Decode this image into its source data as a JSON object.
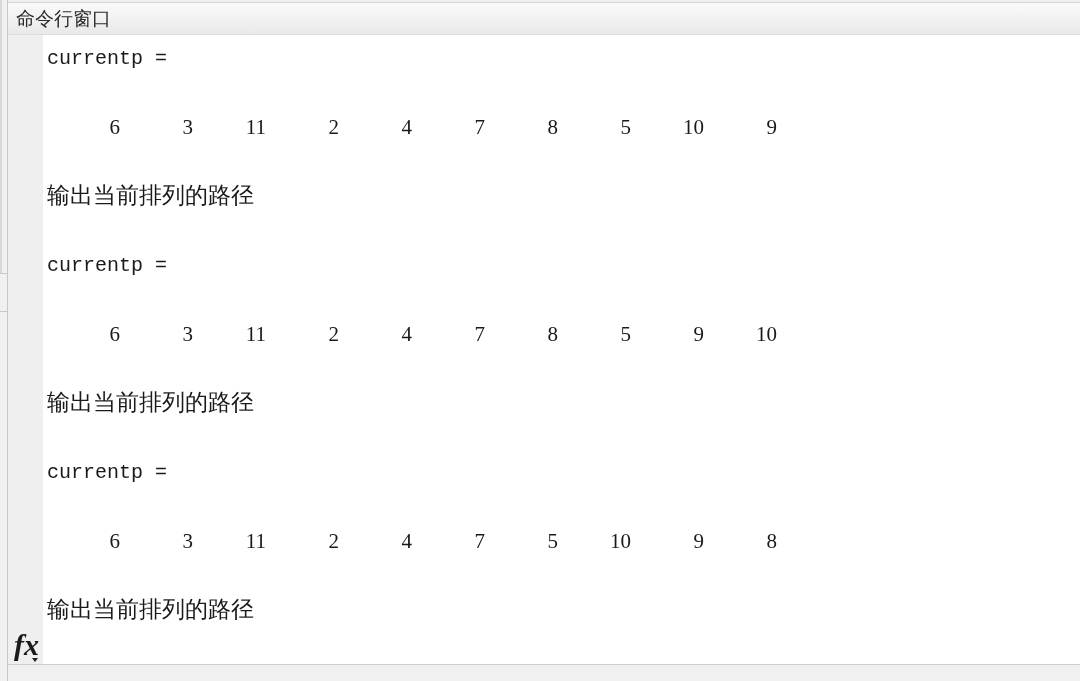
{
  "window": {
    "title": "命令行窗口"
  },
  "output": [
    {
      "variable": "currentp =",
      "values": [
        "6",
        "3",
        "11",
        "2",
        "4",
        "7",
        "8",
        "5",
        "10",
        "9"
      ],
      "message": "输出当前排列的路径"
    },
    {
      "variable": "currentp =",
      "values": [
        "6",
        "3",
        "11",
        "2",
        "4",
        "7",
        "8",
        "5",
        "9",
        "10"
      ],
      "message": "输出当前排列的路径"
    },
    {
      "variable": "currentp =",
      "values": [
        "6",
        "3",
        "11",
        "2",
        "4",
        "7",
        "5",
        "10",
        "9",
        "8"
      ],
      "message": "输出当前排列的路径"
    }
  ],
  "prompt_button": {
    "label": "fx"
  }
}
